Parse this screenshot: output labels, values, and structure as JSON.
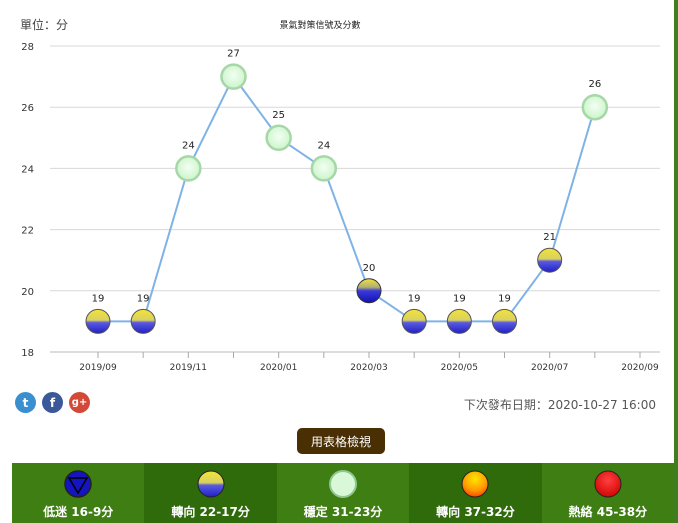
{
  "unit_label": "單位：分",
  "chart_data": {
    "type": "line",
    "title": "景氣對策信號及分數",
    "x": [
      "2019/09",
      "2019/10",
      "2019/11",
      "2019/12",
      "2020/01",
      "2020/02",
      "2020/03",
      "2020/04",
      "2020/05",
      "2020/06",
      "2020/07",
      "2020/08"
    ],
    "x_tick_labels": [
      "2019/09",
      "2019/11",
      "2020/01",
      "2020/03",
      "2020/05",
      "2020/07",
      "2020/09"
    ],
    "values": [
      19,
      19,
      24,
      27,
      25,
      24,
      20,
      19,
      19,
      19,
      21,
      26
    ],
    "signals": [
      "yellow-blue",
      "yellow-blue",
      "green",
      "green",
      "green",
      "green",
      "blue",
      "yellow-blue",
      "yellow-blue",
      "yellow-blue",
      "yellow-blue",
      "green"
    ],
    "ylim": [
      18,
      28
    ],
    "yticks": [
      18,
      20,
      22,
      24,
      26,
      28
    ],
    "grid": true,
    "line_color": "#7fb3e6"
  },
  "social": {
    "twitter": "t",
    "facebook": "f",
    "googleplus": "g+"
  },
  "next_release": "下次發布日期：2020-10-27 16:00",
  "table_view_button": "用表格檢視",
  "legend": [
    {
      "icon": "blue-triangle-icon",
      "label": "低迷 16-9分",
      "color": "#1616c8"
    },
    {
      "icon": "yellow-blue-icon",
      "label": "轉向 22-17分",
      "color": "#e6d21a"
    },
    {
      "icon": "green-icon",
      "label": "穩定 31-23分",
      "color": "#ccf5cc"
    },
    {
      "icon": "yellow-red-icon",
      "label": "轉向 37-32分",
      "color": "#ff9900"
    },
    {
      "icon": "red-icon",
      "label": "熱絡 45-38分",
      "color": "#e00000"
    }
  ]
}
